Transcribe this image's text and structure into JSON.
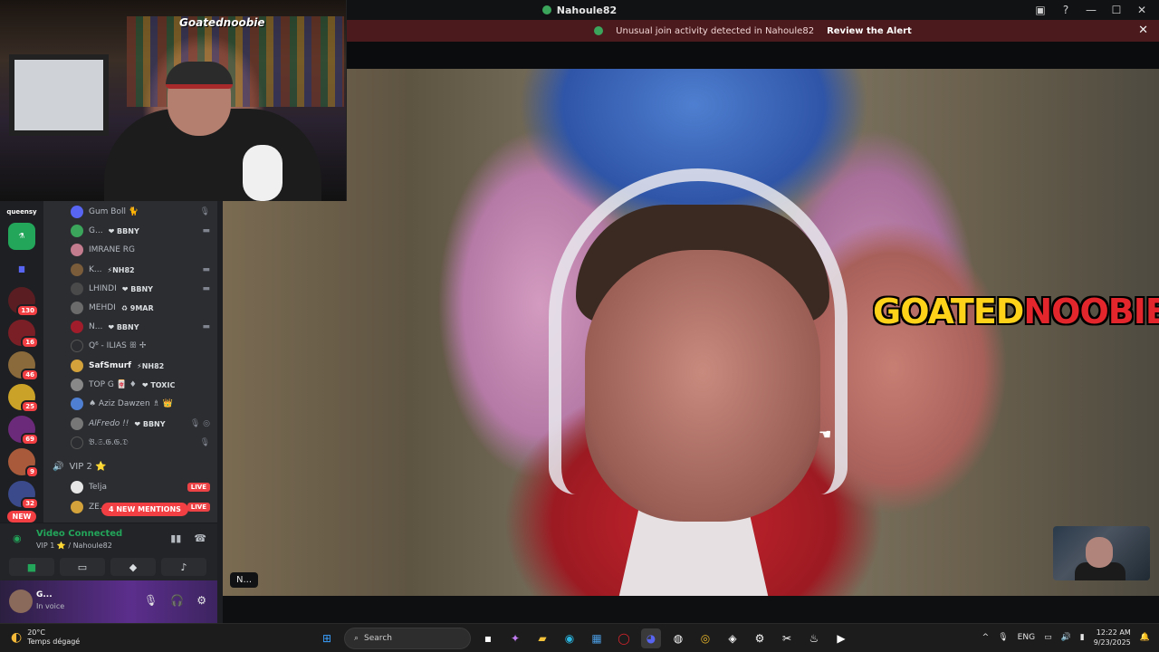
{
  "window": {
    "title": "Nahoule82",
    "back": "←"
  },
  "window_controls": {
    "minimize": "—",
    "maximize": "☐",
    "close": "✕"
  },
  "alert": {
    "message": "Unusual join activity detected in Nahoule82",
    "action": "Review the Alert",
    "close": "✕"
  },
  "stream": {
    "overlay_brand": "Goatednoobie",
    "logo_part1": "GOATED",
    "logo_part2": "NOOBIE",
    "speaker_tag": "N..."
  },
  "servers": {
    "brand": "queensy",
    "items": [
      {
        "badge": ""
      },
      {
        "badge": ""
      },
      {
        "badge": "130"
      },
      {
        "badge": "16"
      },
      {
        "badge": "46"
      },
      {
        "badge": "25"
      },
      {
        "badge": "69"
      },
      {
        "badge": "9"
      },
      {
        "badge": "32"
      }
    ],
    "new_label": "NEW"
  },
  "members": [
    {
      "name": "Gum Boll 🐈",
      "tag": "",
      "right": "🎙",
      "color": "#5865f2"
    },
    {
      "name": "G...",
      "tag": "❤ BBNY",
      "right": "▬",
      "color": "#3ba55c"
    },
    {
      "name": "IMRANE RG",
      "tag": "",
      "right": "",
      "color": "#c27c8e"
    },
    {
      "name": "K...",
      "tag": "⚡NH82",
      "right": "▬",
      "color": "#7a5c3a"
    },
    {
      "name": "LHINDI",
      "tag": "❤ BBNY",
      "right": "▬",
      "color": "#4a4a4a"
    },
    {
      "name": "MEHDI",
      "tag": "♻ 9MAR",
      "right": "",
      "color": "#6b6b6b"
    },
    {
      "name": "N...",
      "tag": "❤ BBNY",
      "right": "▬",
      "color": "#a11d2b"
    },
    {
      "name": "Q⁶ - ILIAS ꕥ ✢",
      "tag": "",
      "right": "",
      "color": "#2b2d31"
    },
    {
      "name": "SafSmurf",
      "tag": "⚡NH82",
      "right": "",
      "color": "#d4a23a"
    },
    {
      "name": "TOP G 🀄 ♦",
      "tag": "❤ TOXIC",
      "right": "",
      "color": "#888888"
    },
    {
      "name": "♠ Aziz Dawzen ♗ 👑",
      "tag": "",
      "right": "",
      "color": "#4f7fd0"
    },
    {
      "name": "AlFredo !!",
      "tag": "❤ BBNY",
      "right": "🎙 ◎",
      "color": "#777777"
    },
    {
      "name": "𝔅.𝔖.𝔊.𝔊.𝔇",
      "tag": "",
      "right": "🎙",
      "color": "#2b2d31"
    }
  ],
  "vip_channel": {
    "label": "VIP 2 ⭐",
    "icon": "🔊"
  },
  "vip_members": [
    {
      "name": "Telja",
      "live": "LIVE"
    },
    {
      "name": "ZE...",
      "live": "LIVE"
    }
  ],
  "mentions_label": "4 NEW MENTIONS",
  "voice": {
    "status": "Video Connected",
    "channel": "VIP 1 ⭐ / Nahoule82"
  },
  "user": {
    "name": "G...",
    "status": "In voice"
  },
  "taskbar": {
    "temp": "20°C",
    "weather": "Temps dégagé",
    "search": "Search",
    "lang": "ENG",
    "time": "12:22 AM",
    "date": "9/23/2025"
  }
}
